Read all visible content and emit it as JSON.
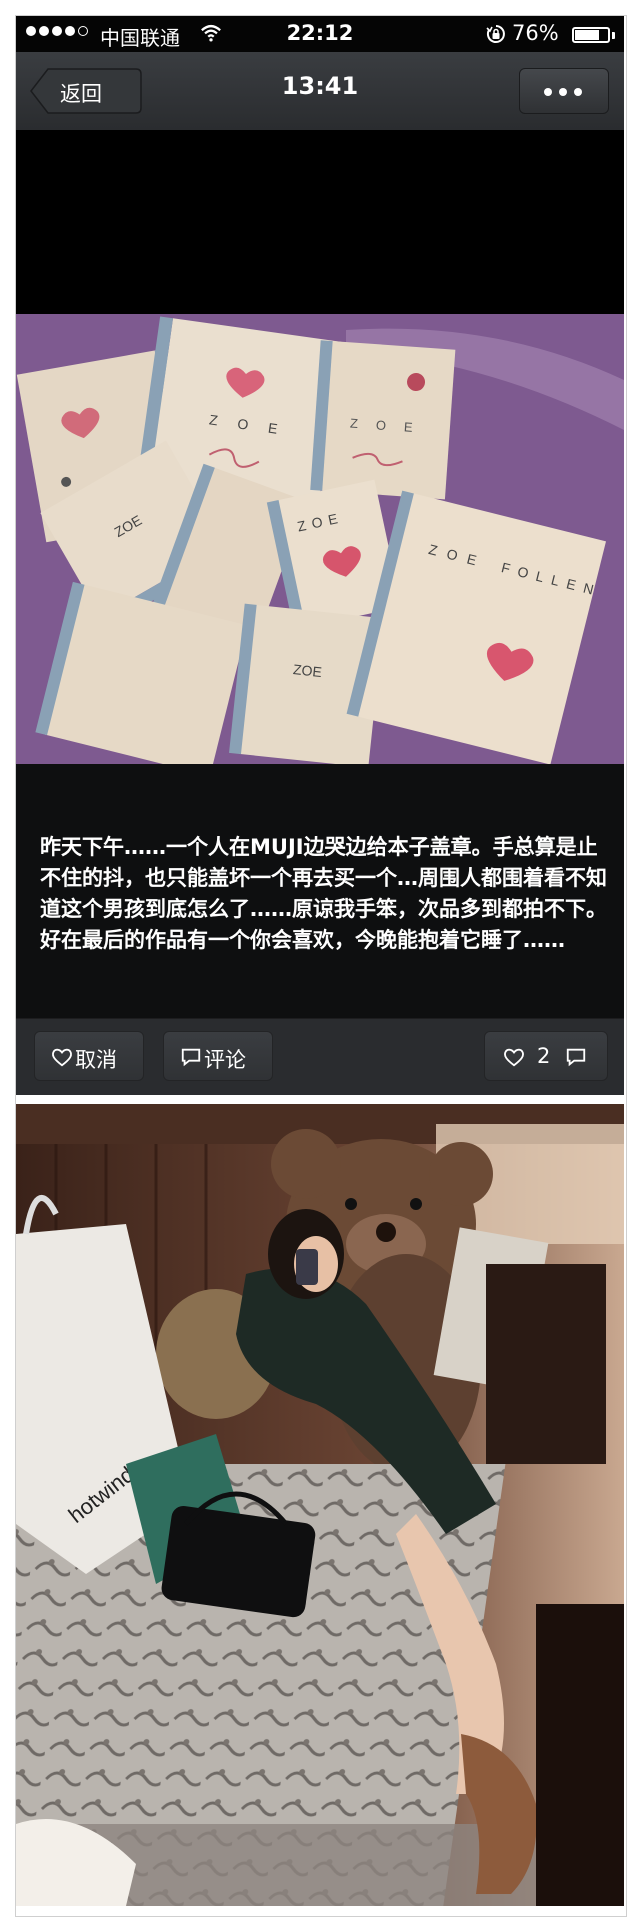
{
  "status_bar": {
    "carrier": "中国联通",
    "time": "22:12",
    "battery": "76%",
    "battery_level": 0.76
  },
  "navbar": {
    "back_label": "返回",
    "title": "13:41"
  },
  "post": {
    "caption": "昨天下午……一个人在MUJI边哭边给本子盖章。手总算是止不住的抖，也只能盖坏一个再去买一个…周围人都围着看不知道这个男孩到底怎么了……原谅我手笨，次品多到都拍不下。好在最后的作品有一个你会喜欢，今晚能抱着它睡了……",
    "photo_text": {
      "zoe": "ZOE",
      "follen": "FOLLEN"
    },
    "actions": {
      "cancel_label": "取消",
      "comment_label": "评论",
      "like_count": "2"
    }
  },
  "photo2_text": {
    "bag_brand": "hotwind"
  }
}
